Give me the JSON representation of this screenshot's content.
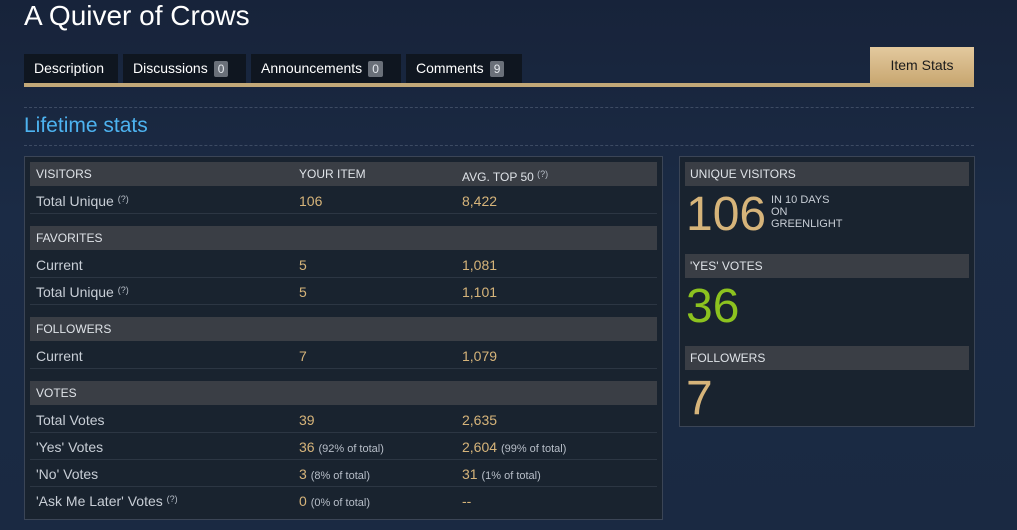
{
  "page": {
    "title": "A Quiver of Crows",
    "section_title": "Lifetime stats"
  },
  "tabs": [
    {
      "label": "Description"
    },
    {
      "label": "Discussions",
      "count": "0"
    },
    {
      "label": "Announcements",
      "count": "0"
    },
    {
      "label": "Comments",
      "count": "9"
    },
    {
      "label": "Item Stats"
    }
  ],
  "stats": {
    "columns": {
      "your_item": "YOUR ITEM",
      "avg_top": "AVG. TOP 50",
      "avg_help": "(?)"
    },
    "visitors": {
      "header": "VISITORS",
      "rows": [
        {
          "label": "Total Unique",
          "help": "(?)",
          "value": "106",
          "avg": "8,422"
        }
      ]
    },
    "favorites": {
      "header": "FAVORITES",
      "rows": [
        {
          "label": "Current",
          "value": "5",
          "avg": "1,081"
        },
        {
          "label": "Total Unique",
          "help": "(?)",
          "value": "5",
          "avg": "1,101"
        }
      ]
    },
    "followers": {
      "header": "FOLLOWERS",
      "rows": [
        {
          "label": "Current",
          "value": "7",
          "avg": "1,079"
        }
      ]
    },
    "votes": {
      "header": "VOTES",
      "rows": [
        {
          "label": "Total Votes",
          "value": "39",
          "avg": "2,635"
        },
        {
          "label": "'Yes' Votes",
          "value": "36",
          "value_pct": "(92% of total)",
          "avg": "2,604",
          "avg_pct": "(99% of total)"
        },
        {
          "label": "'No' Votes",
          "value": "3",
          "value_pct": "(8% of total)",
          "avg": "31",
          "avg_pct": "(1% of total)"
        },
        {
          "label": "'Ask Me Later' Votes",
          "help": "(?)",
          "value": "0",
          "value_pct": "(0% of total)",
          "avg": "--"
        }
      ]
    }
  },
  "summary": {
    "unique_visitors": {
      "header": "UNIQUE VISITORS",
      "value": "106",
      "note1": "IN 10 DAYS",
      "note2": "ON",
      "note3": "GREENLIGHT"
    },
    "yes_votes": {
      "header": "'YES' VOTES",
      "value": "36"
    },
    "followers": {
      "header": "FOLLOWERS",
      "value": "7"
    }
  },
  "colors": {
    "accent_gold": "#d6b47a",
    "yes_green": "#8cc21f",
    "section_blue": "#4db3f0",
    "tab_active": "#d9bd8c"
  }
}
